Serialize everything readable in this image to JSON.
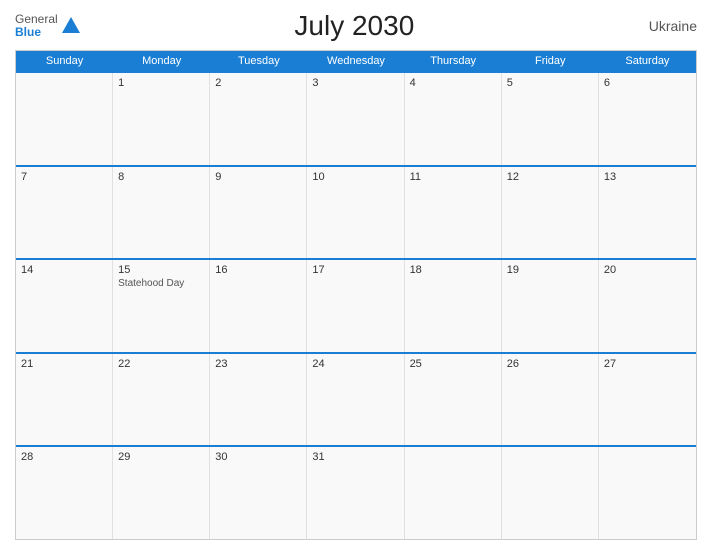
{
  "header": {
    "title": "July 2030",
    "country": "Ukraine",
    "logo": {
      "general": "General",
      "blue": "Blue"
    }
  },
  "calendar": {
    "days": [
      "Sunday",
      "Monday",
      "Tuesday",
      "Wednesday",
      "Thursday",
      "Friday",
      "Saturday"
    ],
    "weeks": [
      [
        {
          "date": "",
          "empty": true
        },
        {
          "date": "1",
          "empty": false
        },
        {
          "date": "2",
          "empty": false
        },
        {
          "date": "3",
          "empty": false
        },
        {
          "date": "4",
          "empty": false
        },
        {
          "date": "5",
          "empty": false
        },
        {
          "date": "6",
          "empty": false
        }
      ],
      [
        {
          "date": "7",
          "empty": false
        },
        {
          "date": "8",
          "empty": false
        },
        {
          "date": "9",
          "empty": false
        },
        {
          "date": "10",
          "empty": false
        },
        {
          "date": "11",
          "empty": false
        },
        {
          "date": "12",
          "empty": false
        },
        {
          "date": "13",
          "empty": false
        }
      ],
      [
        {
          "date": "14",
          "empty": false
        },
        {
          "date": "15",
          "empty": false,
          "event": "Statehood Day"
        },
        {
          "date": "16",
          "empty": false
        },
        {
          "date": "17",
          "empty": false
        },
        {
          "date": "18",
          "empty": false
        },
        {
          "date": "19",
          "empty": false
        },
        {
          "date": "20",
          "empty": false
        }
      ],
      [
        {
          "date": "21",
          "empty": false
        },
        {
          "date": "22",
          "empty": false
        },
        {
          "date": "23",
          "empty": false
        },
        {
          "date": "24",
          "empty": false
        },
        {
          "date": "25",
          "empty": false
        },
        {
          "date": "26",
          "empty": false
        },
        {
          "date": "27",
          "empty": false
        }
      ],
      [
        {
          "date": "28",
          "empty": false
        },
        {
          "date": "29",
          "empty": false
        },
        {
          "date": "30",
          "empty": false
        },
        {
          "date": "31",
          "empty": false
        },
        {
          "date": "",
          "empty": true
        },
        {
          "date": "",
          "empty": true
        },
        {
          "date": "",
          "empty": true
        }
      ]
    ]
  }
}
